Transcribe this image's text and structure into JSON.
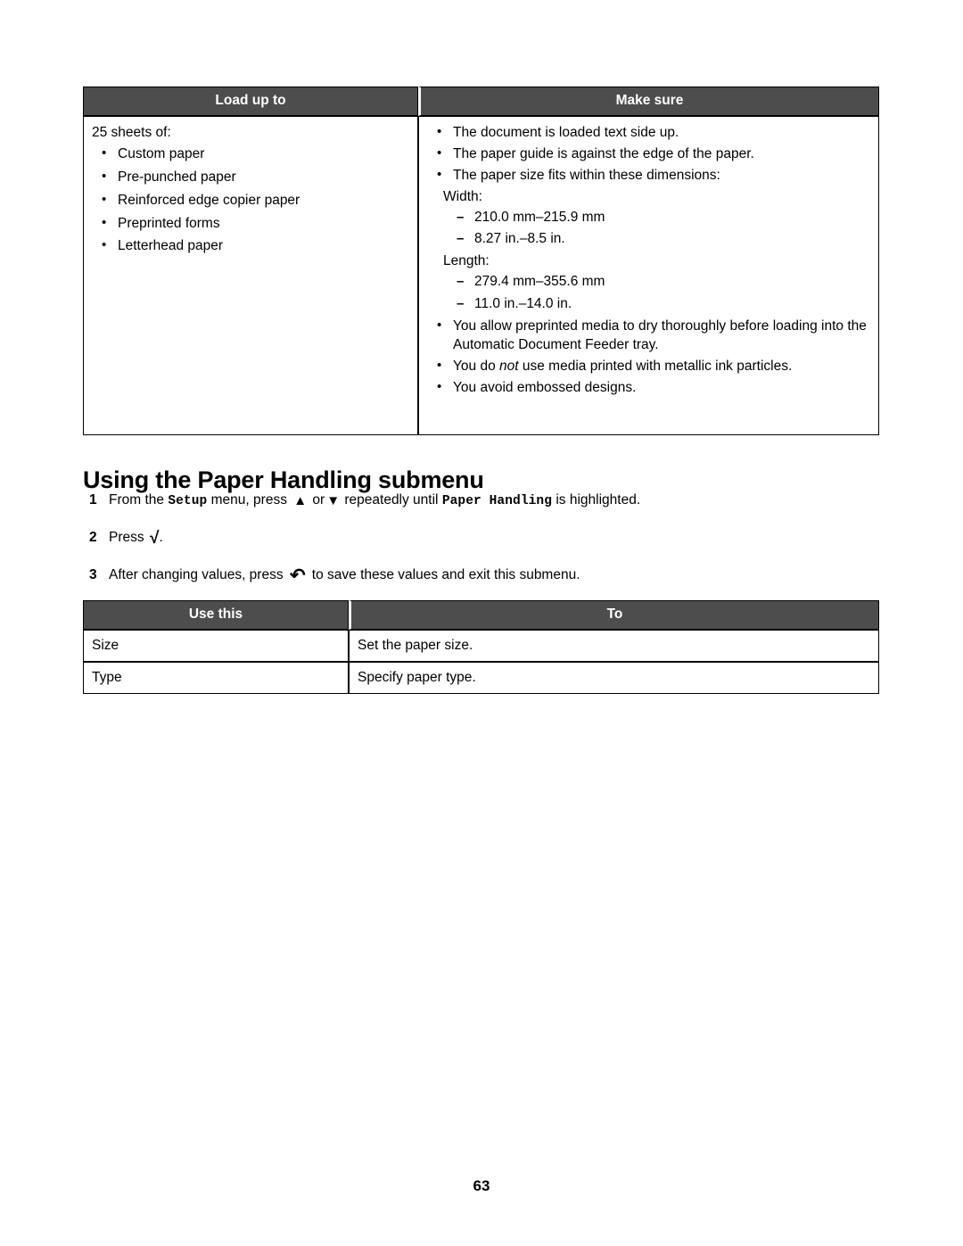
{
  "document": {
    "page_number": "63",
    "accent_header_bg": "#4d4d4d",
    "accent_header_fg": "#ffffff",
    "border_color": "#000000"
  },
  "load_table": {
    "headers": {
      "col1": "Load up to",
      "col2": "Make sure"
    },
    "load_up_to": {
      "intro": "25 sheets of:",
      "items": [
        "Custom paper",
        "Pre-punched paper",
        "Reinforced edge copier paper",
        "Preprinted forms",
        "Letterhead paper"
      ]
    },
    "make_sure": {
      "bullet_1": "The document is loaded text side up.",
      "bullet_2": "The paper guide is against the edge of the paper.",
      "bullet_3": "The paper size fits within these dimensions:",
      "width_label": "Width:",
      "width_mm": "210.0 mm–215.9 mm",
      "width_in": "8.27 in.–8.5 in.",
      "length_label": "Length:",
      "length_mm": "279.4 mm–355.6 mm",
      "length_in": "11.0 in.–14.0 in.",
      "bullet_4": "You allow preprinted media to dry thoroughly before loading into the Automatic Document Feeder tray.",
      "bullet_5_a": "You do ",
      "bullet_5_em": "not",
      "bullet_5_b": " use media printed with metallic ink particles.",
      "bullet_6": "You avoid embossed designs."
    }
  },
  "section": {
    "heading": "Using the Paper Handling submenu",
    "steps": [
      {
        "number": "1",
        "part_a": "From the ",
        "mono_1": "Setup",
        "part_b": " menu, press ",
        "glyph_up": "▲",
        "part_c": " or",
        "glyph_down": "▼",
        "part_d": " repeatedly until ",
        "mono_2": "Paper Handling",
        "part_e": " is highlighted."
      },
      {
        "number": "2",
        "part_a": "Press ",
        "glyph_check": "√",
        "part_b": "."
      },
      {
        "number": "3",
        "part_a": "After changing values, press ",
        "glyph_back": "↷",
        "part_b": " to save these values and exit this submenu."
      }
    ]
  },
  "menu_table": {
    "headers": {
      "col1": "Use this",
      "col2": "To"
    },
    "rows": [
      {
        "use_this": "Size",
        "to": "Set the paper size."
      },
      {
        "use_this": "Type",
        "to": "Specify paper type."
      }
    ]
  }
}
